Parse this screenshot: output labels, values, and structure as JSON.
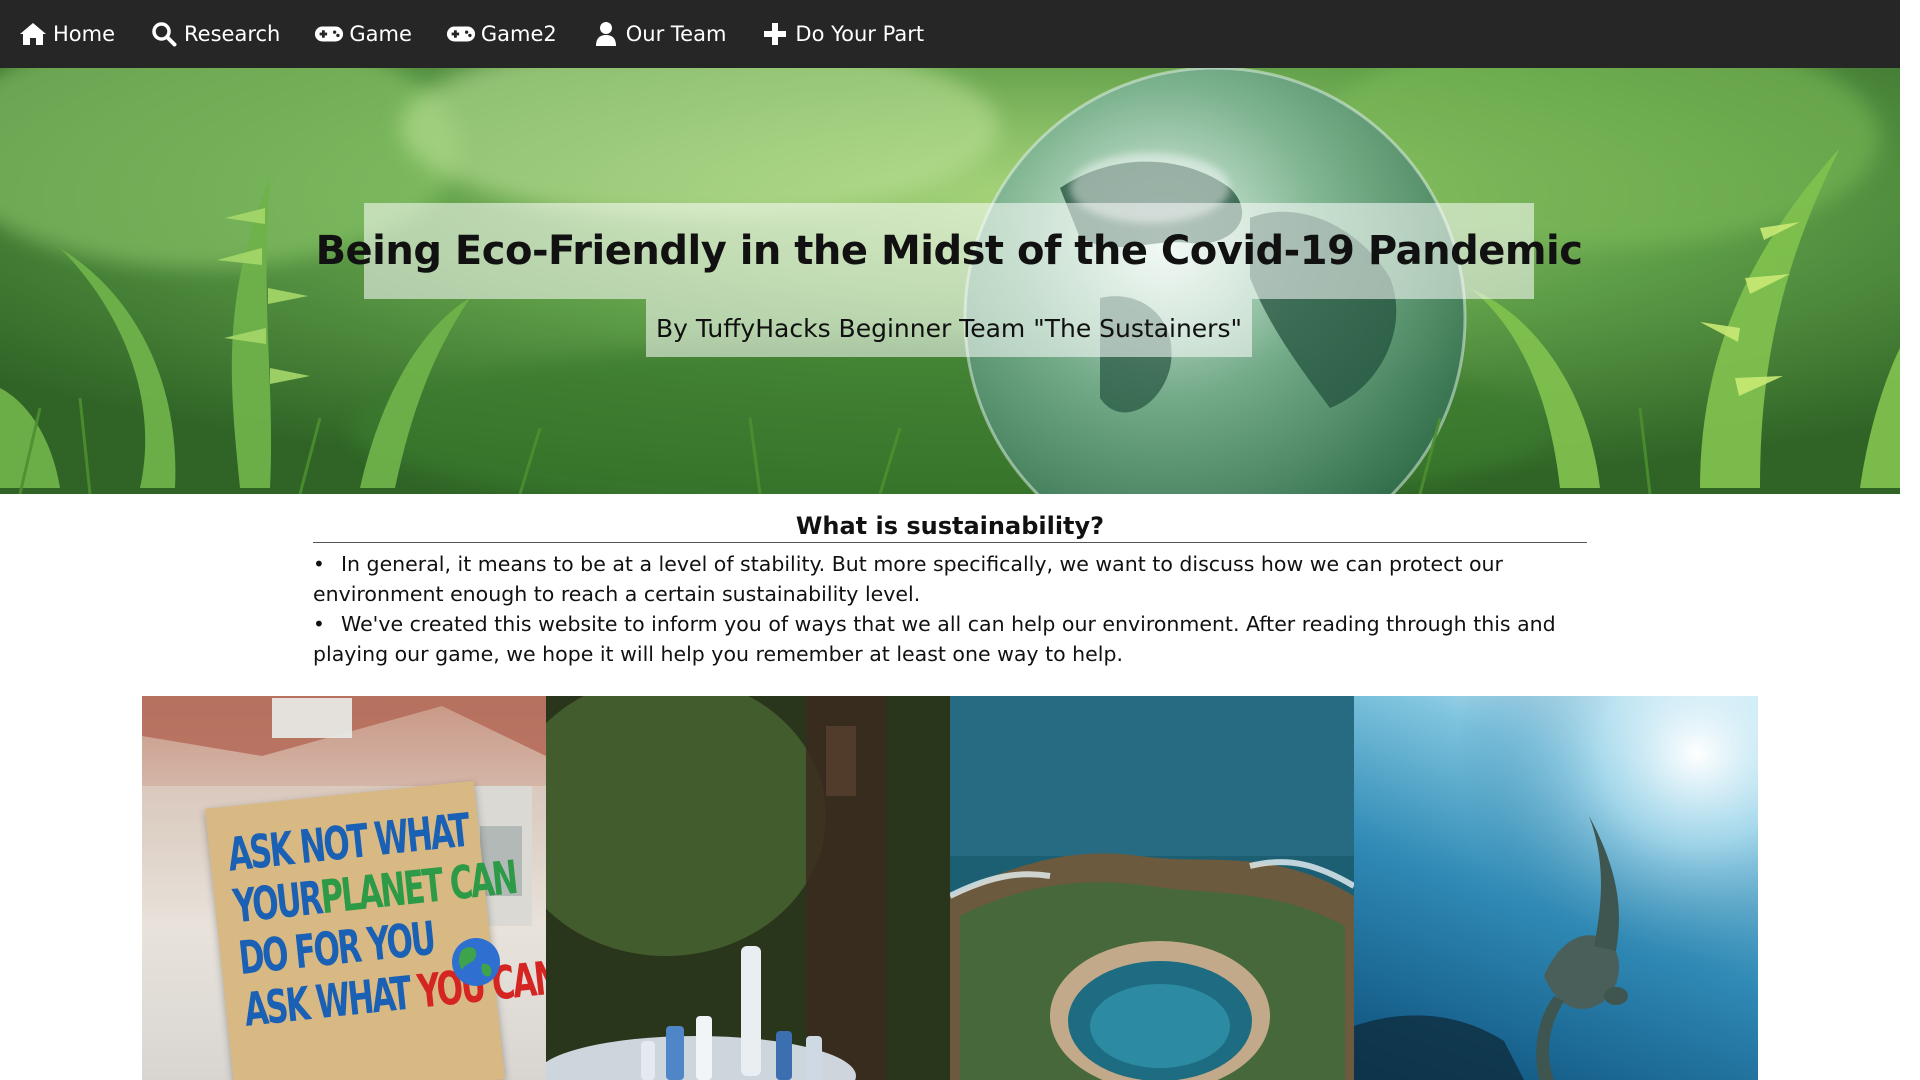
{
  "nav": {
    "items": [
      {
        "label": "Home",
        "icon": "home-icon"
      },
      {
        "label": "Research",
        "icon": "search-icon"
      },
      {
        "label": "Game",
        "icon": "gamepad-icon"
      },
      {
        "label": "Game2",
        "icon": "gamepad-icon"
      },
      {
        "label": "Our Team",
        "icon": "user-icon"
      },
      {
        "label": "Do Your Part",
        "icon": "plus-icon"
      }
    ]
  },
  "hero": {
    "title": "Being Eco-Friendly in the Midst of the Covid-19 Pandemic",
    "subtitle": "By TuffyHacks Beginner Team \"The Sustainers\""
  },
  "intro": {
    "heading": "What is sustainability?",
    "bullets": [
      "In general, it means to be at a level of stability. But more specifically, we want to discuss how we can protect our environment enough to reach a certain sustainability level.",
      "We've created this website to inform you of ways that we all can help our environment. After reading through this and playing our game, we hope it will help you remember at least one way to help."
    ]
  },
  "gallery": {
    "sign": {
      "line1": "ASK NOT WHAT",
      "line2a": "YOUR",
      "line2b": "PLANET CAN",
      "line3": "DO FOR YOU",
      "line4a": "ASK WHAT",
      "line4b": "YOU CAN"
    }
  },
  "colors": {
    "navbar": "#262626",
    "nav_text": "#ffffff",
    "text": "#111111"
  }
}
